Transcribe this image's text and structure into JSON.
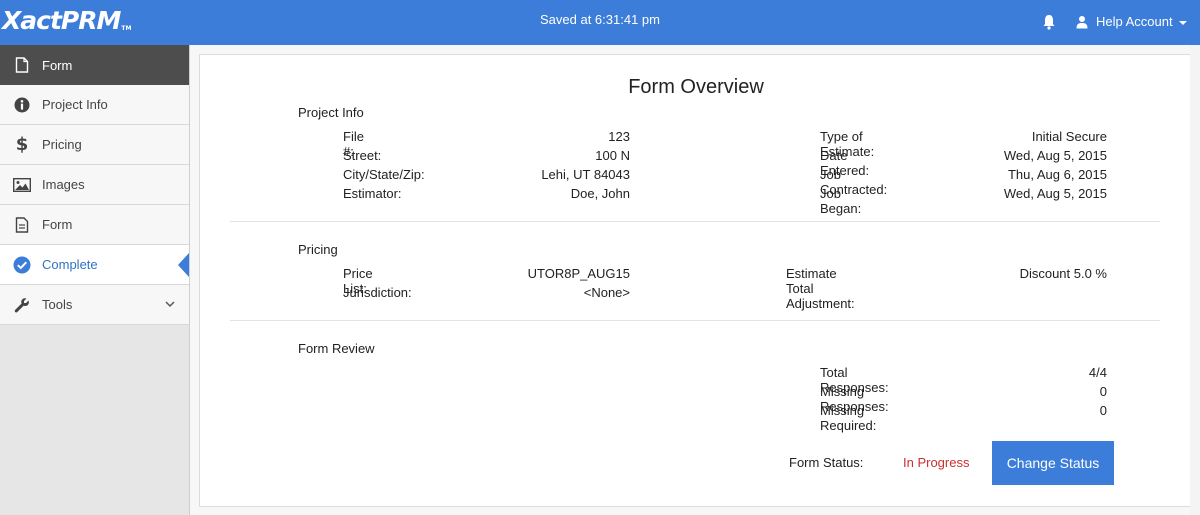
{
  "header": {
    "logo": "XactPRM",
    "logo_tm": "TM",
    "saved_text": "Saved at 6:31:41 pm",
    "account_label": "Help Account"
  },
  "sidebar": {
    "items": [
      {
        "label": "Form",
        "icon": "document-icon"
      },
      {
        "label": "Project Info",
        "icon": "info-icon"
      },
      {
        "label": "Pricing",
        "icon": "dollar-icon"
      },
      {
        "label": "Images",
        "icon": "image-icon"
      },
      {
        "label": "Form",
        "icon": "form-icon"
      },
      {
        "label": "Complete",
        "icon": "check-circle-icon"
      },
      {
        "label": "Tools",
        "icon": "wrench-icon"
      }
    ]
  },
  "overview": {
    "title": "Form Overview",
    "project_info": {
      "heading": "Project Info",
      "left": [
        {
          "label": "File #:",
          "value": "123"
        },
        {
          "label": "Street:",
          "value": "100 N"
        },
        {
          "label": "City/State/Zip:",
          "value": "Lehi, UT 84043"
        },
        {
          "label": "Estimator:",
          "value": "Doe, John"
        }
      ],
      "right": [
        {
          "label": "Type of Estimate:",
          "value": "Initial Secure"
        },
        {
          "label": "Date Entered:",
          "value": "Wed, Aug 5, 2015"
        },
        {
          "label": "Job Contracted:",
          "value": "Thu, Aug 6, 2015"
        },
        {
          "label": "Job Began:",
          "value": "Wed, Aug 5, 2015"
        }
      ]
    },
    "pricing": {
      "heading": "Pricing",
      "left": [
        {
          "label": "Price List:",
          "value": "UTOR8P_AUG15"
        },
        {
          "label": "Jurisdiction:",
          "value": "<None>"
        }
      ],
      "right": [
        {
          "label": "Estimate Total Adjustment:",
          "value": "Discount 5.0 %"
        }
      ]
    },
    "form_review": {
      "heading": "Form Review",
      "right": [
        {
          "label": "Total Responses:",
          "value": "4/4"
        },
        {
          "label": "Missing Responses:",
          "value": "0"
        },
        {
          "label": "Missing Required:",
          "value": "0"
        }
      ]
    },
    "status": {
      "label": "Form Status:",
      "value": "In Progress",
      "button": "Change Status"
    }
  },
  "colors": {
    "accent": "#3b7dd8",
    "sidebar_header": "#4d4d4d",
    "status_text": "#c9302c"
  }
}
